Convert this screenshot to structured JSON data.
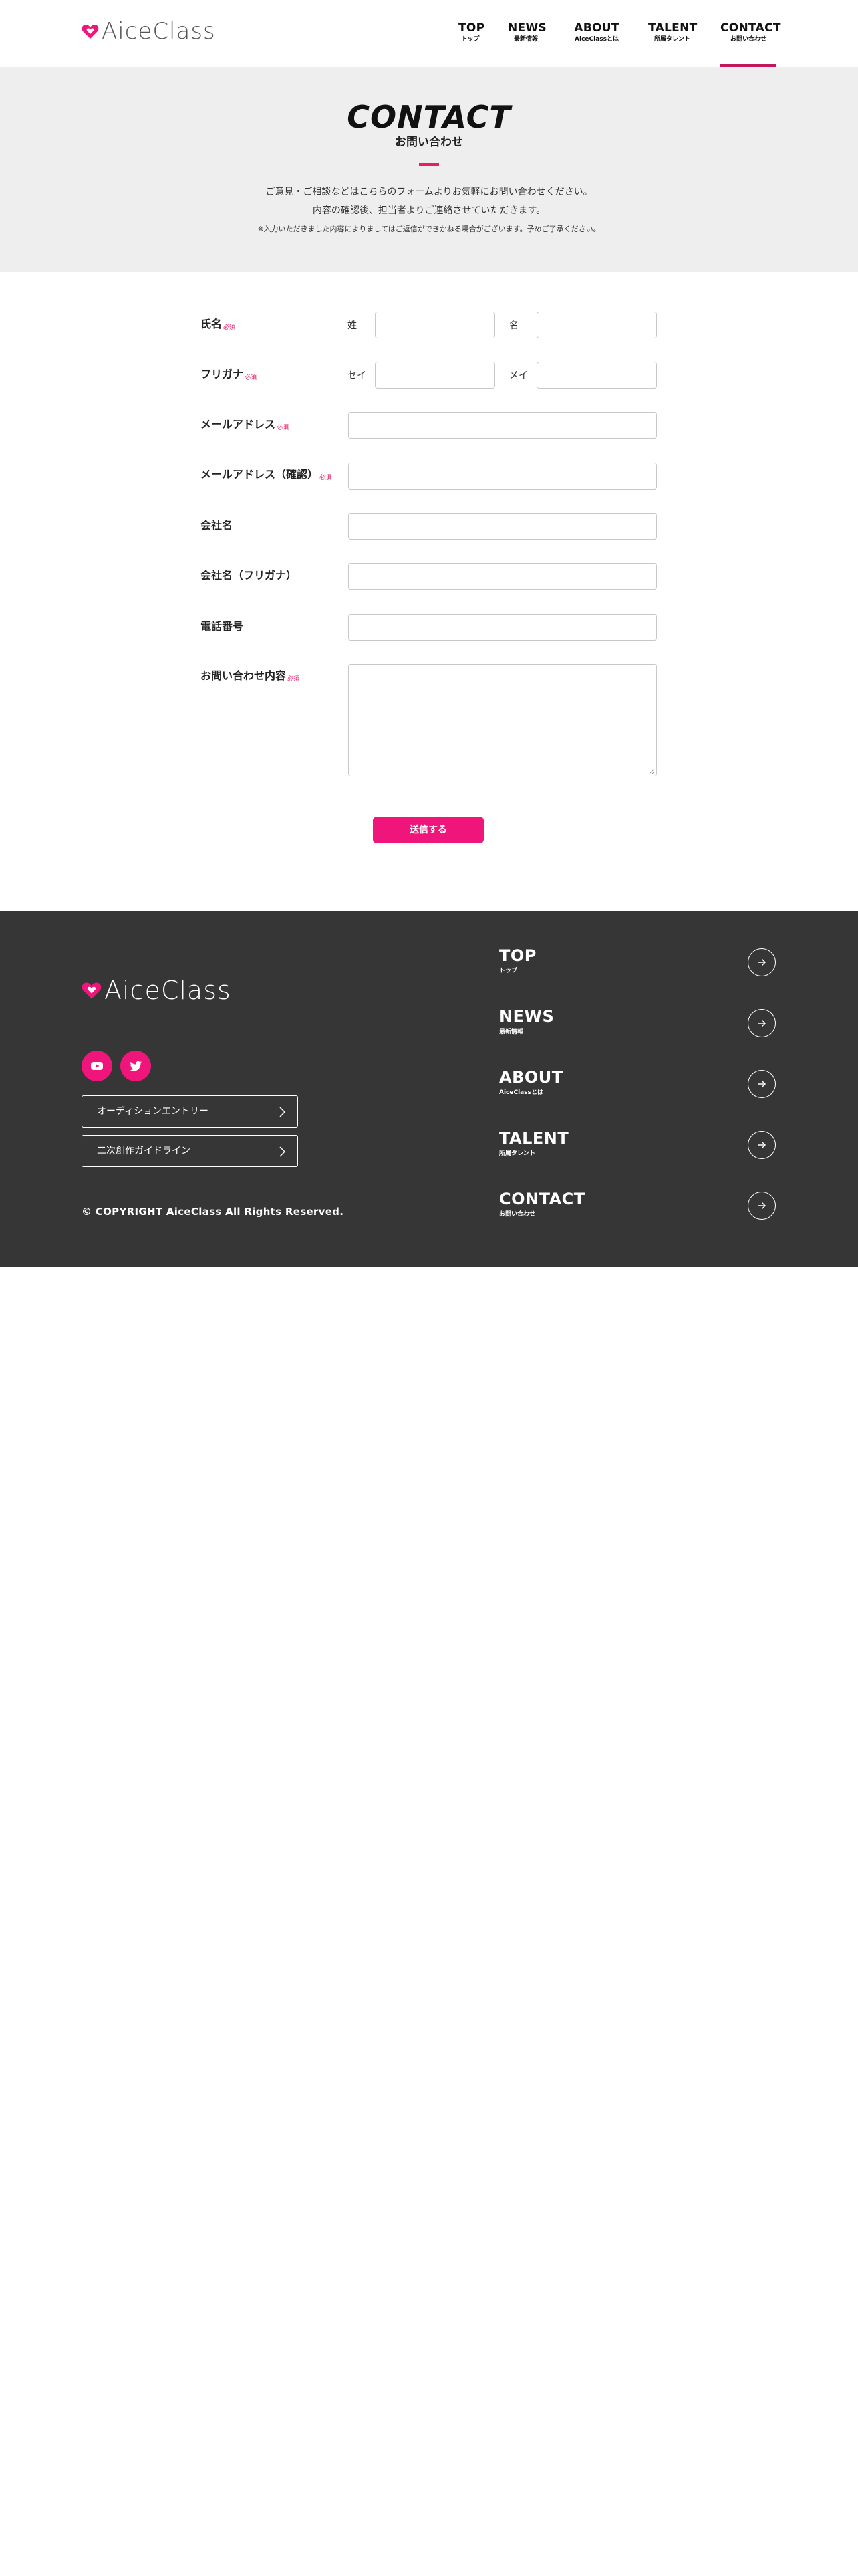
{
  "brand": {
    "logo_text": "AiceClass",
    "accent_color": "#f0157b",
    "accent_dark": "#c2185b"
  },
  "nav": {
    "items": [
      {
        "en": "TOP",
        "ja": "トップ"
      },
      {
        "en": "NEWS",
        "ja": "最新情報"
      },
      {
        "en": "ABOUT",
        "ja": "AiceClassとは"
      },
      {
        "en": "TALENT",
        "ja": "所属タレント"
      },
      {
        "en": "CONTACT",
        "ja": "お問い合わせ"
      }
    ],
    "active": "CONTACT"
  },
  "hero": {
    "title": "CONTACT",
    "subtitle": "お問い合わせ",
    "line1": "ご意見・ご相談などはこちらのフォームよりお気軽にお問い合わせください。",
    "line2": "内容の確認後、担当者よりご連絡させていただきます。",
    "note": "※入力いただきました内容によりましてはご返信ができかねる場合がございます。予めご了承ください。"
  },
  "form": {
    "required_mark": "必須",
    "name": {
      "label": "氏名",
      "last": "姓",
      "first": "名",
      "last_value": "",
      "first_value": ""
    },
    "kana": {
      "label": "フリガナ",
      "last": "セイ",
      "first": "メイ",
      "last_value": "",
      "first_value": ""
    },
    "email": {
      "label": "メールアドレス",
      "value": ""
    },
    "email_confirm": {
      "label": "メールアドレス（確認）",
      "value": ""
    },
    "company": {
      "label": "会社名",
      "value": ""
    },
    "company_kana": {
      "label": "会社名（フリガナ）",
      "value": ""
    },
    "phone": {
      "label": "電話番号",
      "value": ""
    },
    "message": {
      "label": "お問い合わせ内容",
      "value": ""
    },
    "submit_label": "送信する"
  },
  "footer": {
    "logo_text": "AiceClass",
    "social": [
      "youtube-icon",
      "twitter-icon"
    ],
    "buttons": [
      "オーディションエントリー",
      "二次創作ガイドライン"
    ],
    "copyright": "© COPYRIGHT AiceClass All Rights Reserved.",
    "nav": [
      {
        "en": "TOP",
        "ja": "トップ"
      },
      {
        "en": "NEWS",
        "ja": "最新情報"
      },
      {
        "en": "ABOUT",
        "ja": "AiceClassとは"
      },
      {
        "en": "TALENT",
        "ja": "所属タレント"
      },
      {
        "en": "CONTACT",
        "ja": "お問い合わせ"
      }
    ]
  }
}
